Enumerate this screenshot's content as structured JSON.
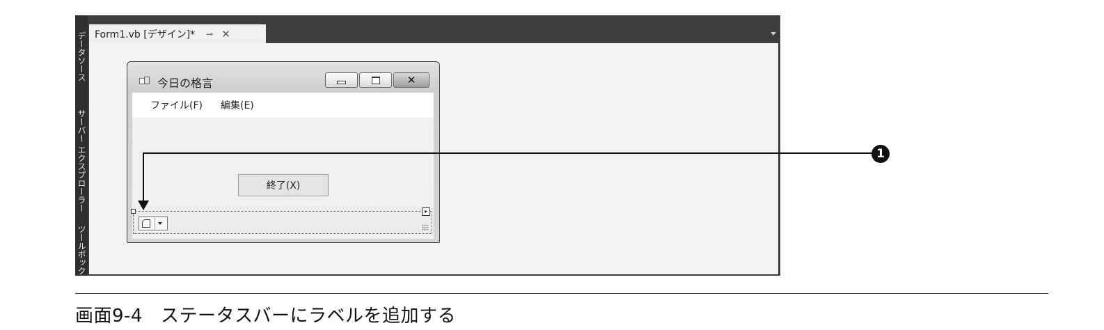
{
  "ide": {
    "side_tabs": [
      "データソース",
      "サーバー エクスプローラー",
      "ツールボック"
    ],
    "document_tab": {
      "title": "Form1.vb [デザイン]*",
      "pin_glyph": "⊸",
      "close_glyph": "✕"
    }
  },
  "form": {
    "title": "今日の格言",
    "caption_buttons": {
      "minimize": "",
      "maximize": "",
      "close": "✕"
    },
    "menu": [
      "ファイル(F)",
      "編集(E)"
    ],
    "exit_button": "終了(X)",
    "statusstrip": {
      "smart_tag_glyph": "▸",
      "add_item_dropdown": ""
    }
  },
  "callout": {
    "number": "1"
  },
  "caption": {
    "figure_no": "画面9-4",
    "text": "ステータスバーにラベルを追加する"
  }
}
